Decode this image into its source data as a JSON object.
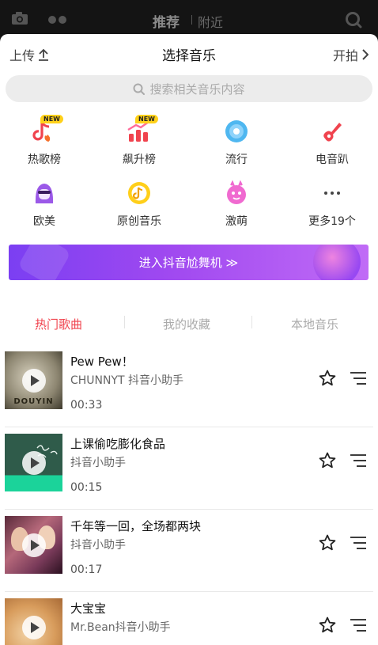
{
  "topbar": {
    "tab_recommend": "推荐",
    "tab_nearby": "附近"
  },
  "header": {
    "upload_label": "上传",
    "title": "选择音乐",
    "start_label": "开拍"
  },
  "search": {
    "placeholder": "搜索相关音乐内容"
  },
  "categories": [
    {
      "label": "热歌榜",
      "icon": "hot-songs-icon",
      "badge": "NEW"
    },
    {
      "label": "飙升榜",
      "icon": "rising-chart-icon",
      "badge": "NEW"
    },
    {
      "label": "流行",
      "icon": "pop-disc-icon"
    },
    {
      "label": "电音趴",
      "icon": "electronic-guitar-icon"
    },
    {
      "label": "欧美",
      "icon": "western-avatar-icon"
    },
    {
      "label": "原创音乐",
      "icon": "original-music-icon"
    },
    {
      "label": "激萌",
      "icon": "cute-monster-icon"
    },
    {
      "label": "更多19个",
      "icon": "more-dots-icon"
    }
  ],
  "banner": {
    "label": "进入抖音尬舞机 ≫"
  },
  "tabs": {
    "hot": "热门歌曲",
    "favorites": "我的收藏",
    "local": "本地音乐",
    "active": "hot"
  },
  "songs": [
    {
      "name": "Pew Pew！",
      "artist": "CHUNNYT 抖音小助手",
      "duration": "00:33",
      "cover_text": "DOUYIN"
    },
    {
      "name": "上课偷吃膨化食品",
      "artist": "抖音小助手",
      "duration": "00:15"
    },
    {
      "name": "千年等一回，全场都两块",
      "artist": "抖音小助手",
      "duration": "00:17"
    },
    {
      "name": "大宝宝",
      "artist": "Mr.Bean抖音小助手",
      "duration": ""
    }
  ],
  "colors": {
    "accent_red": "#f0434e",
    "banner_purple": "#8b3df0",
    "tab_inactive": "#aaaaaa"
  }
}
